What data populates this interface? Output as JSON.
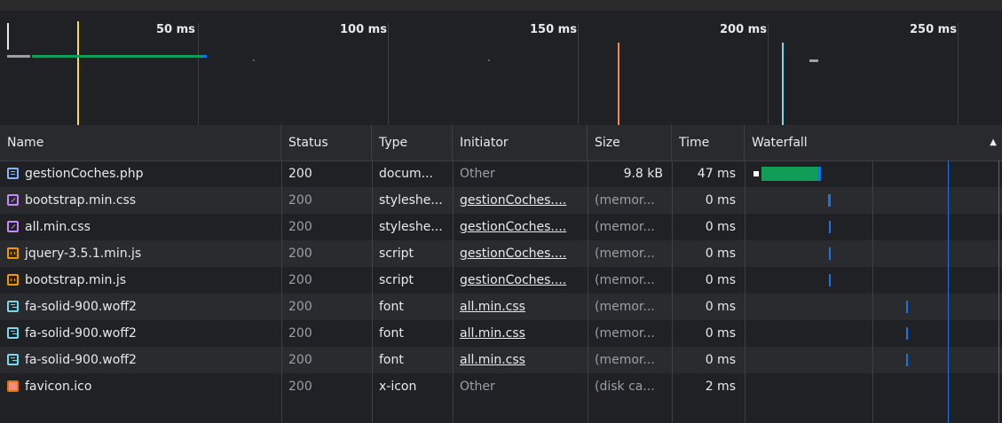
{
  "overview": {
    "ticks": [
      "50 ms",
      "100 ms",
      "150 ms",
      "200 ms",
      "250 ms"
    ]
  },
  "columns": {
    "name": "Name",
    "status": "Status",
    "type": "Type",
    "initiator": "Initiator",
    "size": "Size",
    "time": "Time",
    "waterfall": "Waterfall"
  },
  "rows": [
    {
      "icon": "document-icon",
      "name": "gestionCoches.php",
      "status": "200",
      "type": "docum...",
      "initiator": "Other",
      "size": "9.8 kB",
      "time": "47 ms"
    },
    {
      "icon": "stylesheet-icon",
      "name": "bootstrap.min.css",
      "status": "200",
      "type": "styleshe...",
      "initiator": "gestionCoches....",
      "size": "(memor...",
      "time": "0 ms"
    },
    {
      "icon": "stylesheet-icon",
      "name": "all.min.css",
      "status": "200",
      "type": "styleshe...",
      "initiator": "gestionCoches....",
      "size": "(memor...",
      "time": "0 ms"
    },
    {
      "icon": "script-icon",
      "name": "jquery-3.5.1.min.js",
      "status": "200",
      "type": "script",
      "initiator": "gestionCoches....",
      "size": "(memor...",
      "time": "0 ms"
    },
    {
      "icon": "script-icon",
      "name": "bootstrap.min.js",
      "status": "200",
      "type": "script",
      "initiator": "gestionCoches....",
      "size": "(memor...",
      "time": "0 ms"
    },
    {
      "icon": "font-icon",
      "name": "fa-solid-900.woff2",
      "status": "200",
      "type": "font",
      "initiator": "all.min.css",
      "size": "(memor...",
      "time": "0 ms"
    },
    {
      "icon": "font-icon",
      "name": "fa-solid-900.woff2",
      "status": "200",
      "type": "font",
      "initiator": "all.min.css",
      "size": "(memor...",
      "time": "0 ms"
    },
    {
      "icon": "font-icon",
      "name": "fa-solid-900.woff2",
      "status": "200",
      "type": "font",
      "initiator": "all.min.css",
      "size": "(memor...",
      "time": "0 ms"
    },
    {
      "icon": "image-icon",
      "name": "favicon.ico",
      "status": "200",
      "type": "x-icon",
      "initiator": "Other",
      "size": "(disk ca...",
      "time": "2 ms"
    }
  ],
  "colors": {
    "dom_content_loaded": "#fdd663",
    "load": "#ee675c",
    "waiting_bar": "#0f9d58",
    "download_bar": "#1a73e8"
  }
}
